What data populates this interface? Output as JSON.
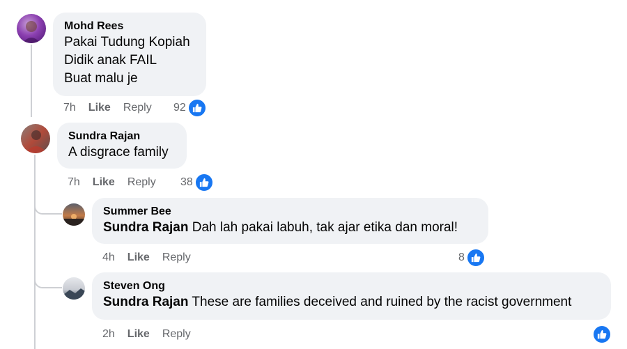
{
  "comments": [
    {
      "author": "Mohd Rees",
      "lines": [
        "Pakai Tudung Kopiah",
        "Didik anak FAIL",
        "Buat malu je"
      ],
      "time": "7h",
      "like": "Like",
      "reply": "Reply",
      "reactions": "92"
    },
    {
      "author": "Sundra Rajan",
      "lines": [
        "A disgrace family"
      ],
      "time": "7h",
      "like": "Like",
      "reply": "Reply",
      "reactions": "38"
    },
    {
      "author": "Summer Bee",
      "mention": "Sundra Rajan",
      "text": " Dah lah pakai labuh, tak ajar etika dan moral!",
      "time": "4h",
      "like": "Like",
      "reply": "Reply",
      "reactions": "8"
    },
    {
      "author": "Steven Ong",
      "mention": "Sundra Rajan",
      "text": " These are families deceived and ruined by the racist government",
      "time": "2h",
      "like": "Like",
      "reply": "Reply",
      "reactions": ""
    }
  ],
  "colors": {
    "bubble": "#f0f2f5",
    "like_blue": "#1877f2",
    "meta": "#65676b"
  },
  "icons": {
    "reaction": "thumbs-up-icon"
  }
}
